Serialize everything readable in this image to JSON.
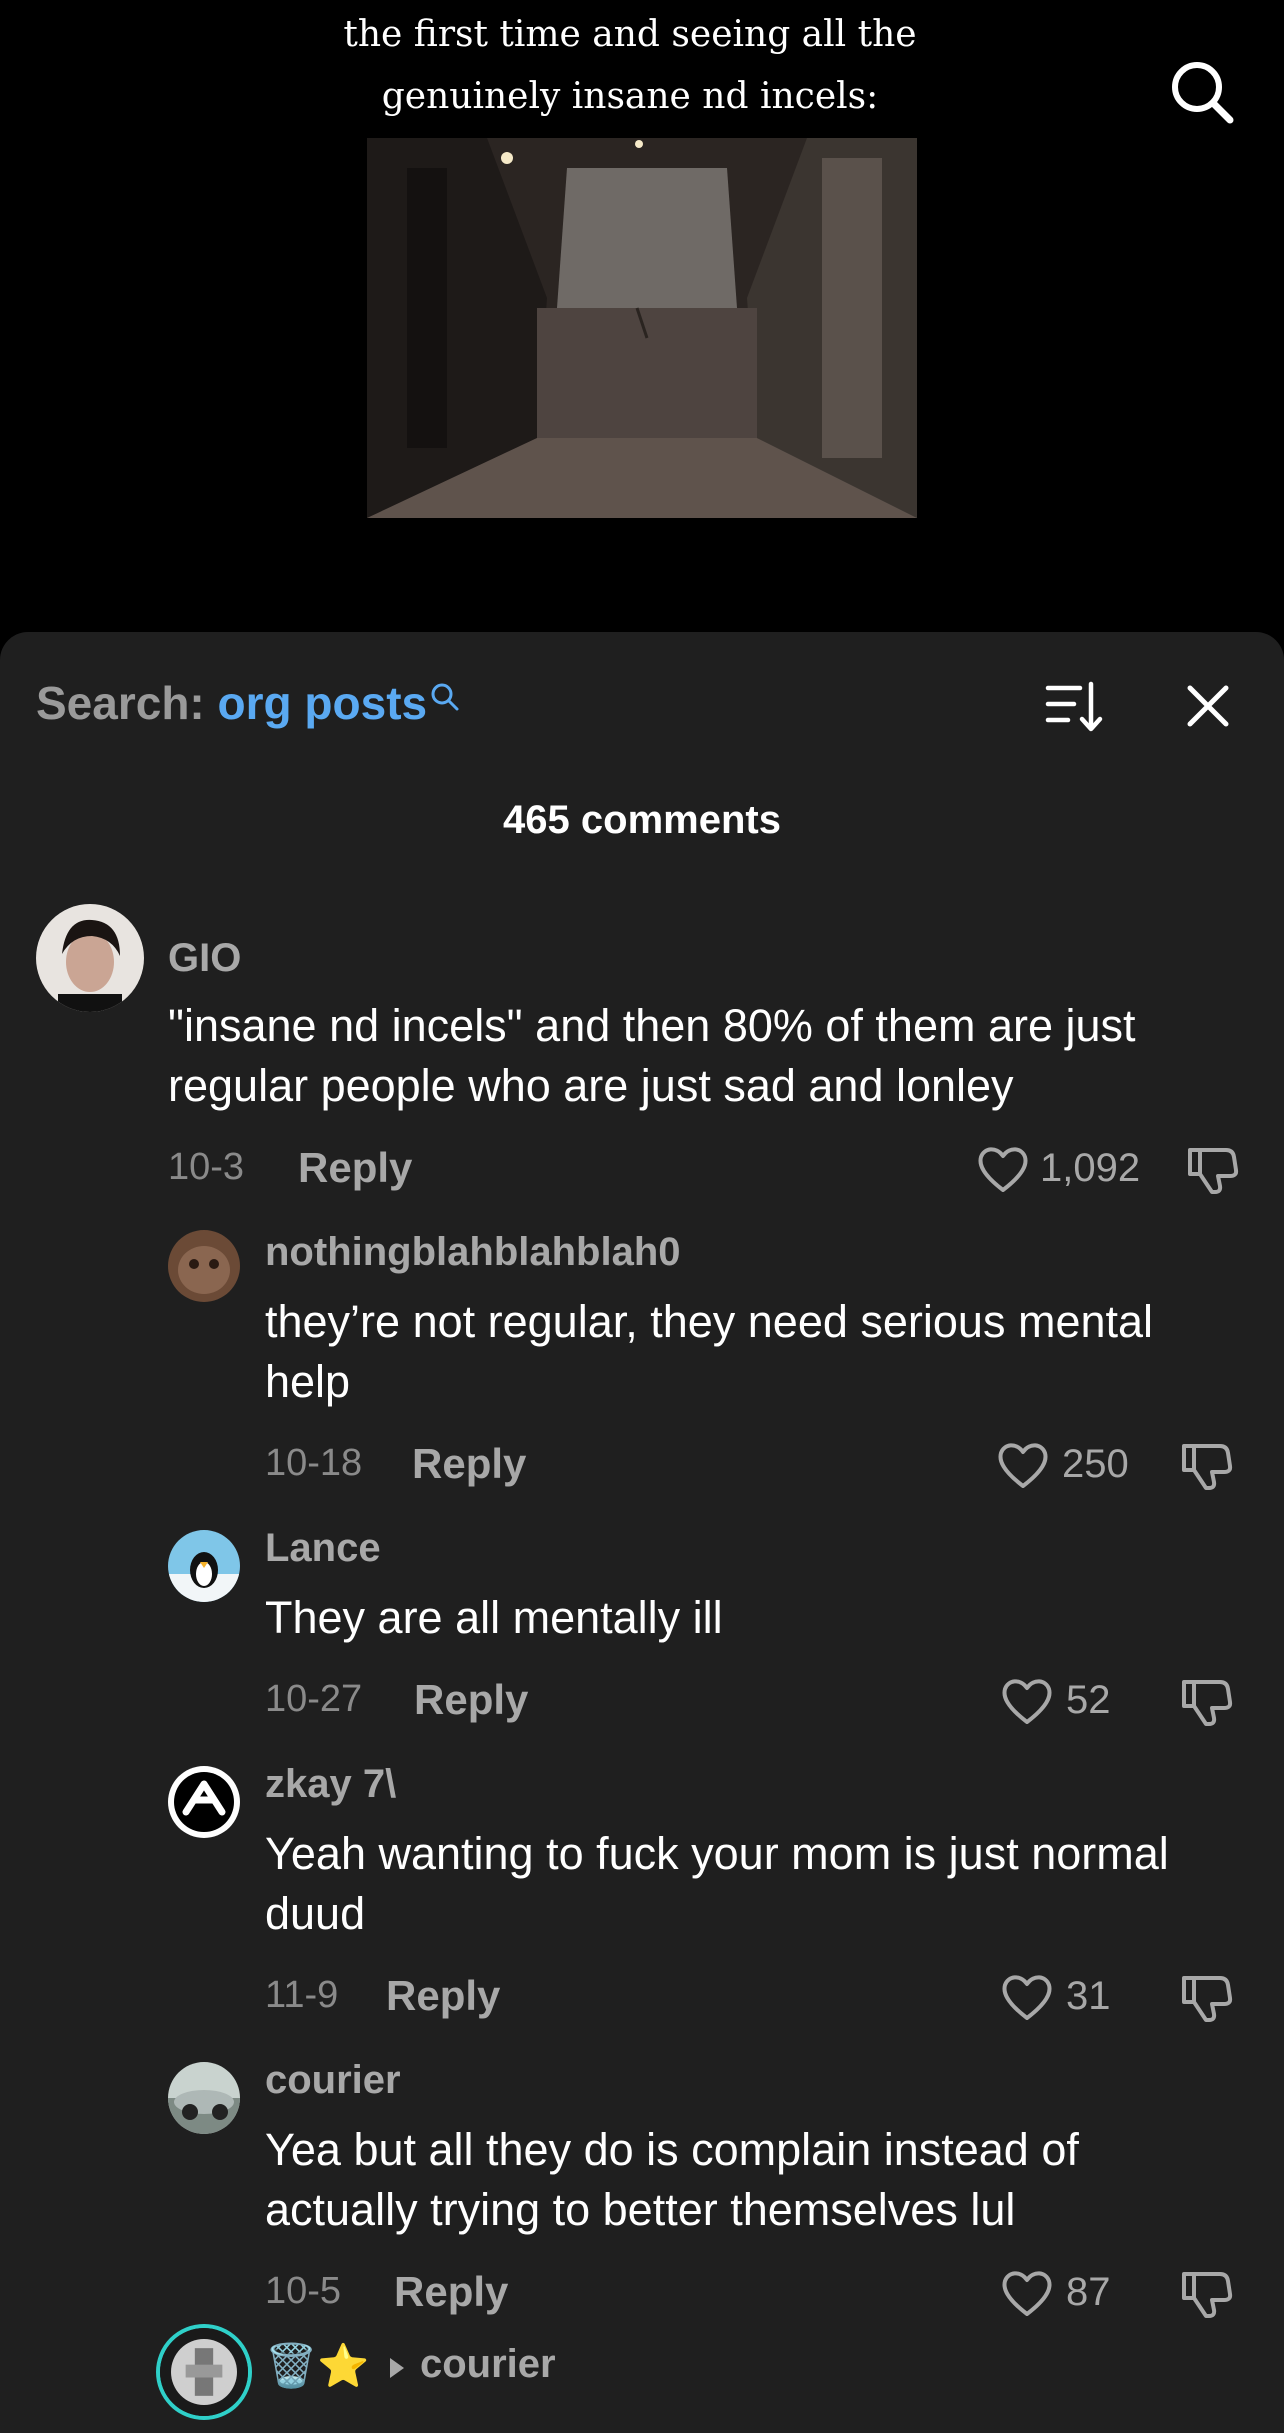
{
  "video": {
    "caption_line1": "the first time and seeing all the",
    "caption_line2": "genuinely insane nd incels:"
  },
  "sheet": {
    "search_prefix": "Search:",
    "search_term": "org posts",
    "comment_count": "465 comments"
  },
  "comments": [
    {
      "username": "GIO",
      "text_line1": "\"insane nd incels\" and then 80% of them are just",
      "text_line2": "regular people who are just sad and lonley",
      "date": "10-3",
      "reply": "Reply",
      "likes": "1,092"
    },
    {
      "username": "nothingblahblahblah0",
      "text_line1": "they’re not regular, they need serious mental",
      "text_line2": "help",
      "date": "10-18",
      "reply": "Reply",
      "likes": "250"
    },
    {
      "username": "Lance",
      "text_line1": "They are all mentally ill",
      "date": "10-27",
      "reply": "Reply",
      "likes": "52"
    },
    {
      "username": "zkay 7\\",
      "text_line1": "Yeah wanting to fuck your mom is just normal",
      "text_line2": "duud",
      "date": "11-9",
      "reply": "Reply",
      "likes": "31"
    },
    {
      "username": "courier",
      "text_line1": "Yea but all they do is complain instead of",
      "text_line2": "actually trying to better themselves lul",
      "date": "10-5",
      "reply": "Reply",
      "likes": "87"
    },
    {
      "username_emoji": "🗑️⭐",
      "reply_to": "courier"
    }
  ],
  "colors": {
    "sheet_bg": "#1f1f1f",
    "search_term": "#5aa9f2",
    "muted_text": "#a8a8a8"
  },
  "icons": [
    "search-icon",
    "sort-icon",
    "close-icon",
    "heart-icon",
    "dislike-icon",
    "reply-arrow-icon"
  ]
}
